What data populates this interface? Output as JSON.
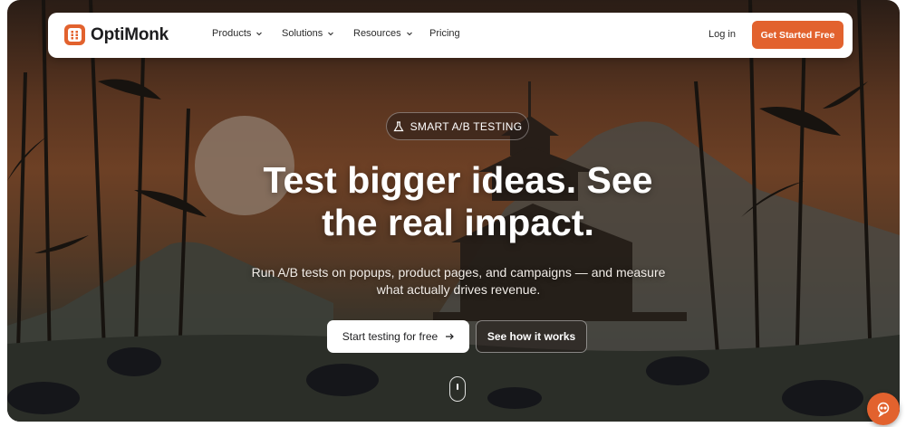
{
  "brand": {
    "name": "OptiMonk",
    "accent": "#e2622e"
  },
  "nav": {
    "items": [
      {
        "label": "Products",
        "has_dropdown": true
      },
      {
        "label": "Solutions",
        "has_dropdown": true
      },
      {
        "label": "Resources",
        "has_dropdown": true
      },
      {
        "label": "Pricing",
        "has_dropdown": false
      }
    ],
    "login_label": "Log in",
    "cta_label": "Get Started Free"
  },
  "hero": {
    "badge_icon": "flask-icon",
    "badge_label": "SMART A/B TESTING",
    "headline_line1": "Test bigger ideas. See",
    "headline_line2": "the real impact.",
    "subtext_line1": "Run A/B tests on popups, product pages, and campaigns — and measure",
    "subtext_line2": "what actually drives revenue.",
    "primary_button": "Start testing for free",
    "primary_button_icon": "arrow-right-icon",
    "secondary_button": "See how it works",
    "scroll_icon": "mouse-scroll-icon"
  },
  "chat_widget": {
    "icon": "chat-assistant-icon"
  }
}
